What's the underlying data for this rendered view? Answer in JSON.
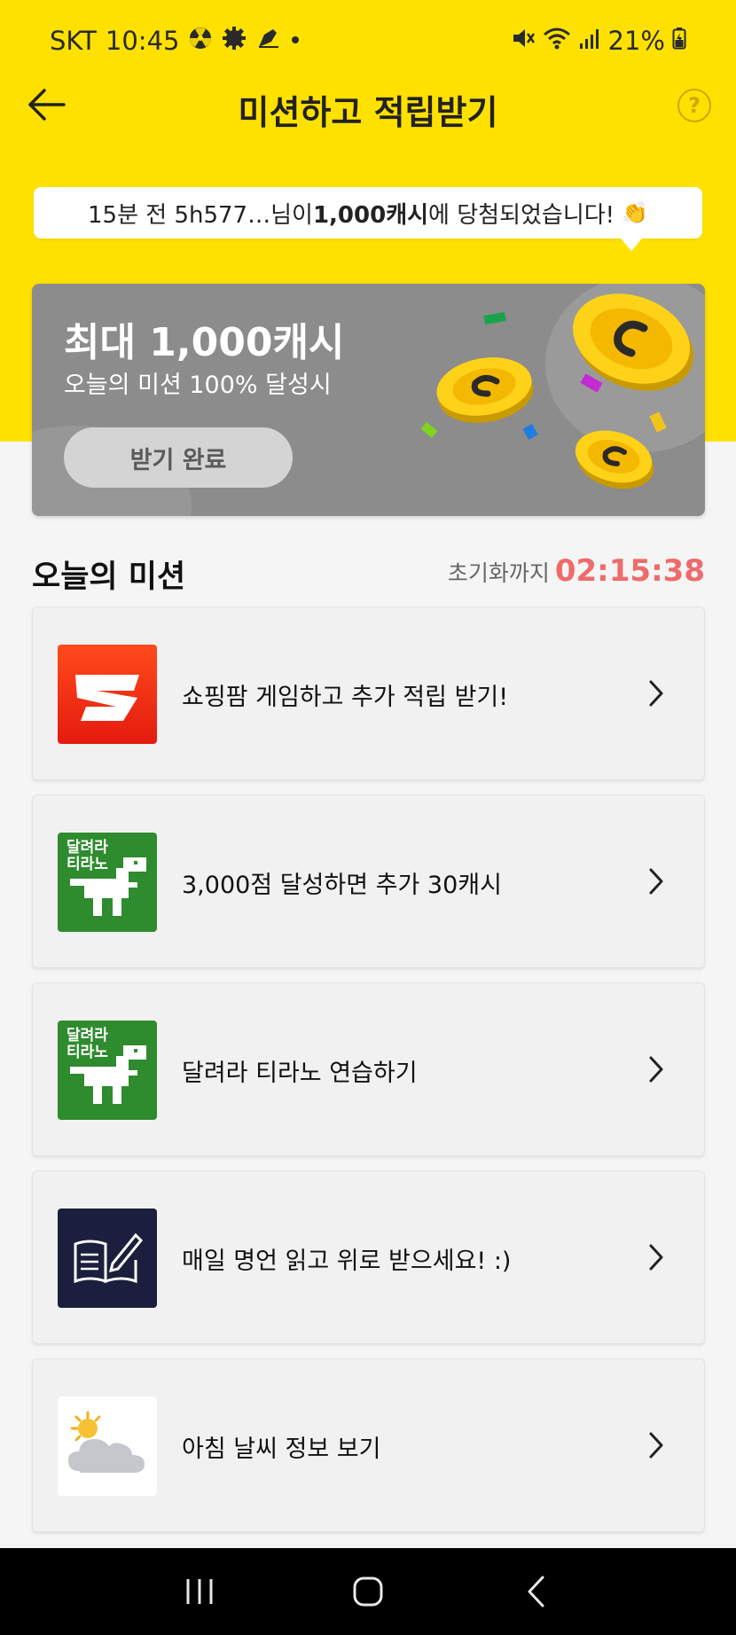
{
  "status_bar": {
    "carrier": "SKT",
    "time": "10:45",
    "battery": "21%"
  },
  "header": {
    "title": "미션하고 적립받기",
    "help_label": "?"
  },
  "toast": {
    "prefix": "15분 전 5h577…님이 ",
    "amount": "1,000캐시",
    "suffix": "에 당첨되었습니다!",
    "emoji": "👏"
  },
  "reward": {
    "title": "최대 1,000캐시",
    "subtitle": "오늘의 미션 100% 달성시",
    "button_label": "받기 완료"
  },
  "missions_section": {
    "title": "오늘의 미션",
    "reset_label": "초기화까지",
    "reset_time": "02:15:38",
    "reset_color": "#ef6b6b"
  },
  "missions": [
    {
      "label": "쇼핑팜 게임하고 추가 적립 받기!",
      "icon": "shoppingfarm-logo-icon"
    },
    {
      "label": "3,000점 달성하면 추가 30캐시",
      "icon": "dino-run-icon",
      "thumb_text": "달려라\n티라노"
    },
    {
      "label": "달려라 티라노 연습하기",
      "icon": "dino-run-icon",
      "thumb_text": "달려라\n티라노"
    },
    {
      "label": "매일 명언 읽고 위로 받으세요! :)",
      "icon": "book-pen-icon"
    },
    {
      "label": "아침 날씨 정보 보기",
      "icon": "weather-sun-cloud-icon"
    }
  ],
  "colors": {
    "brand_yellow": "#ffe100",
    "card_gray": "#8c8c8c"
  }
}
